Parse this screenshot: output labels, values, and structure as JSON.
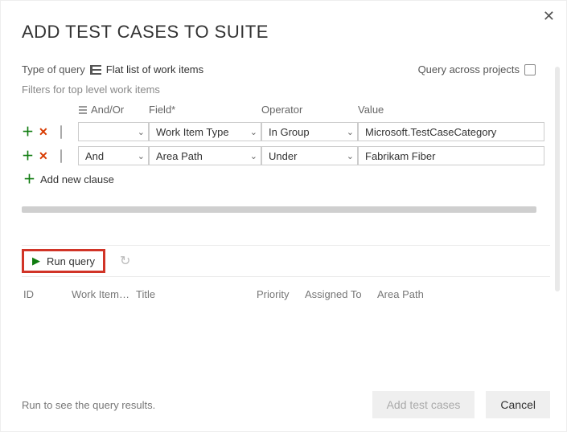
{
  "title": "ADD TEST CASES TO SUITE",
  "topRow": {
    "typeLabel": "Type of query",
    "typeValue": "Flat list of work items",
    "acrossLabel": "Query across projects"
  },
  "filtersLabel": "Filters for top level work items",
  "headers": {
    "andOr": "And/Or",
    "field": "Field*",
    "operator": "Operator",
    "value": "Value"
  },
  "rows": [
    {
      "andOr": "",
      "field": "Work Item Type",
      "operator": "In Group",
      "value": "Microsoft.TestCaseCategory"
    },
    {
      "andOr": "And",
      "field": "Area Path",
      "operator": "Under",
      "value": "Fabrikam Fiber"
    }
  ],
  "addClause": "Add new clause",
  "toolbar": {
    "runQuery": "Run query"
  },
  "resultHeaders": {
    "id": "ID",
    "workItem": "Work Item…",
    "title": "Title",
    "priority": "Priority",
    "assigned": "Assigned To",
    "area": "Area Path"
  },
  "hint": "Run to see the query results.",
  "buttons": {
    "add": "Add test cases",
    "cancel": "Cancel"
  }
}
